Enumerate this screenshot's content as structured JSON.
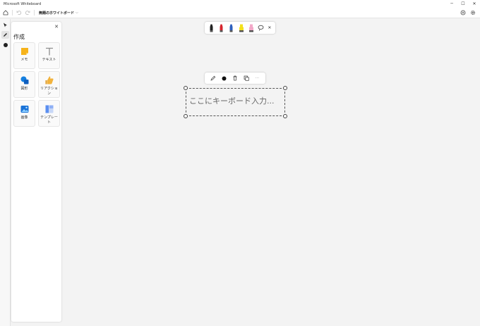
{
  "window": {
    "title": "Microsoft Whiteboard",
    "minimize": "─",
    "maximize": "☐",
    "close": "✕"
  },
  "toolbar": {
    "board_title": "無題のホワイトボード",
    "chevron": "⌵"
  },
  "panel": {
    "title": "作成",
    "close": "✕",
    "tiles": [
      {
        "label": "メモ",
        "icon": "sticky-note-icon",
        "color": "#f6b31b"
      },
      {
        "label": "テキスト",
        "icon": "text-icon",
        "color": "#8f8f8f"
      },
      {
        "label": "図形",
        "icon": "shapes-icon",
        "color": "#1480e0"
      },
      {
        "label": "リアクション",
        "icon": "reaction-icon",
        "color": "#f2b33d"
      },
      {
        "label": "画像",
        "icon": "image-icon",
        "color": "#1a73d8"
      },
      {
        "label": "テンプレート",
        "icon": "template-icon",
        "color": "#5b8ff0"
      }
    ]
  },
  "pens": [
    {
      "icon": "black-pen-icon",
      "color": "#222222"
    },
    {
      "icon": "red-pen-icon",
      "color": "#d6262e"
    },
    {
      "icon": "blue-pen-icon",
      "color": "#2d5fbd"
    },
    {
      "icon": "yellow-highlighter-icon",
      "color": "#f3e11c"
    },
    {
      "icon": "pink-highlighter-icon",
      "color": "#f2a8c8"
    }
  ],
  "tray_close": "✕",
  "text_tools": {
    "more": "···"
  },
  "textbox": {
    "placeholder": "ここにキーボード入力..."
  }
}
